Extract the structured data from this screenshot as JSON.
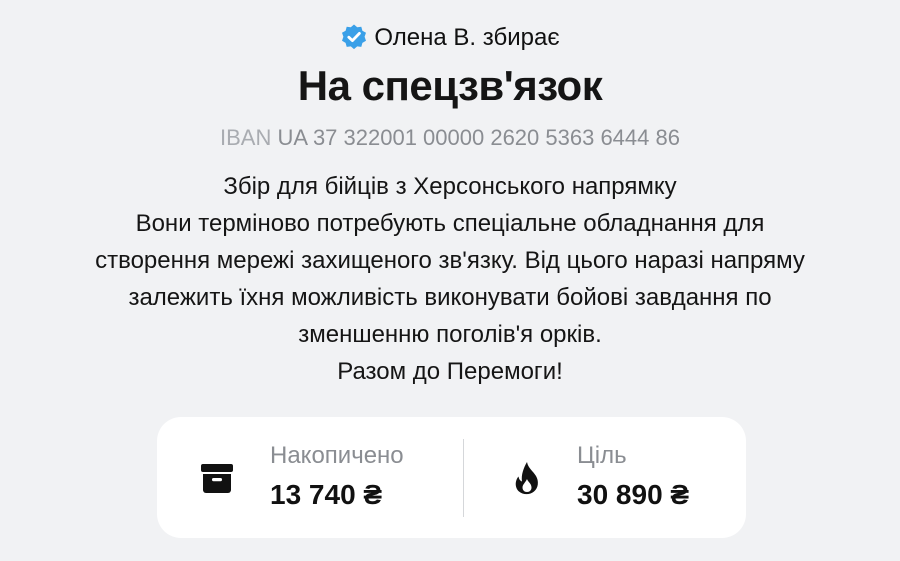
{
  "jar": {
    "owner": "Олена В. збирає",
    "title": "На спецзв'язок",
    "iban_label": "IBAN",
    "iban_value": "UA 37 322001 00000 2620 5363 6444 86",
    "description_lines": [
      "Збір для бійців з Херсонського напрямку",
      "Вони терміново потребують спеціальне обладнання для",
      "створення мережі захищеного зв'язку. Від цього наразі напряму",
      "залежить їхня можливість виконувати бойові завдання по",
      "зменшенню поголів'я орків.",
      "Разом до Перемоги!"
    ]
  },
  "stats": {
    "collected": {
      "label": "Накопичено",
      "value": "13 740 ₴",
      "icon": "archive-box-icon"
    },
    "goal": {
      "label": "Ціль",
      "value": "30 890 ₴",
      "icon": "flame-icon"
    }
  },
  "colors": {
    "background": "#f1f2f4",
    "card": "#ffffff",
    "verified_badge": "#3aa0e8",
    "muted_text": "#8a8d92"
  }
}
